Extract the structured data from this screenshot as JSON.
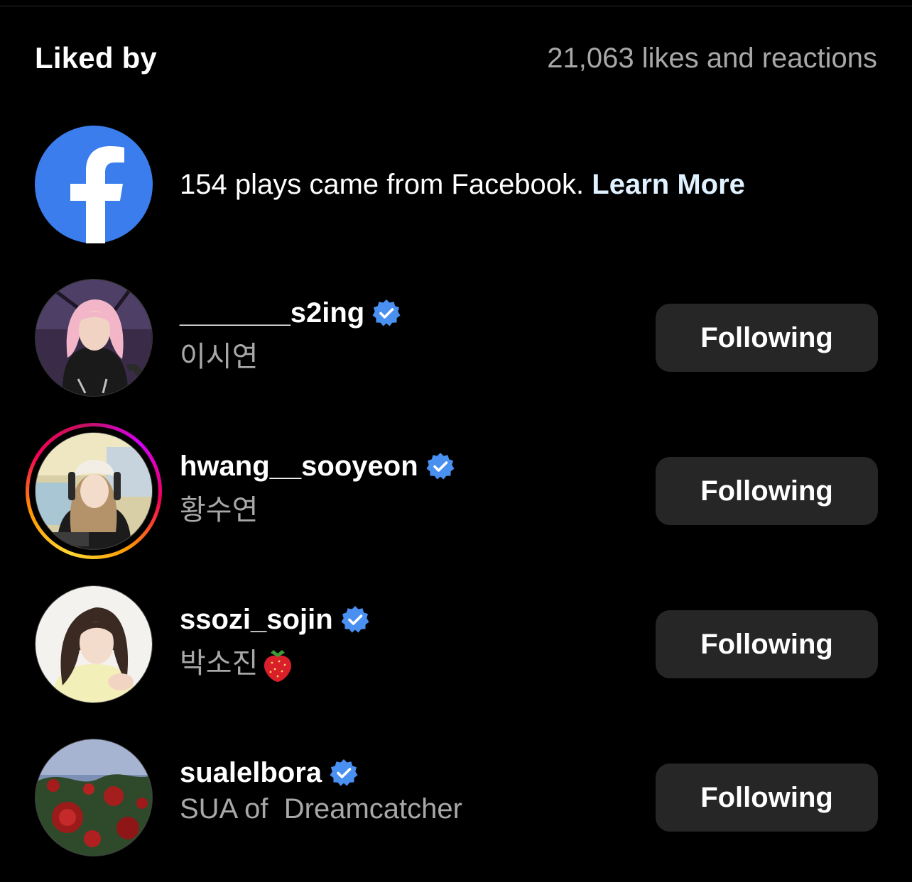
{
  "header": {
    "title": "Liked by",
    "count_text": "21,063 likes and reactions"
  },
  "facebook_notice": {
    "text": "154 plays came from Facebook. ",
    "link_label": "Learn More",
    "icon": "facebook-logo-icon",
    "brand_color": "#3b7ded"
  },
  "users": [
    {
      "username": "_______s2ing",
      "full_name": "이시연",
      "verified": true,
      "has_story_ring": false,
      "avatar_icon": "avatar-pink-hair",
      "button_label": "Following"
    },
    {
      "username": "hwang__sooyeon",
      "full_name": "황수연",
      "verified": true,
      "has_story_ring": true,
      "avatar_icon": "avatar-beanie",
      "button_label": "Following"
    },
    {
      "username": "ssozi_sojin",
      "full_name": "박소진",
      "full_name_emoji": "strawberry-icon",
      "verified": true,
      "has_story_ring": false,
      "avatar_icon": "avatar-portrait",
      "button_label": "Following"
    },
    {
      "username": "sualelbora",
      "full_name": "SUA of  Dreamcatcher",
      "verified": true,
      "has_story_ring": false,
      "avatar_icon": "avatar-roses",
      "button_label": "Following"
    }
  ],
  "colors": {
    "background": "#000000",
    "secondary_text": "#a8a8a8",
    "button_bg": "#262626",
    "verified_badge": "#4a90f0",
    "link": "#e0f1ff"
  }
}
